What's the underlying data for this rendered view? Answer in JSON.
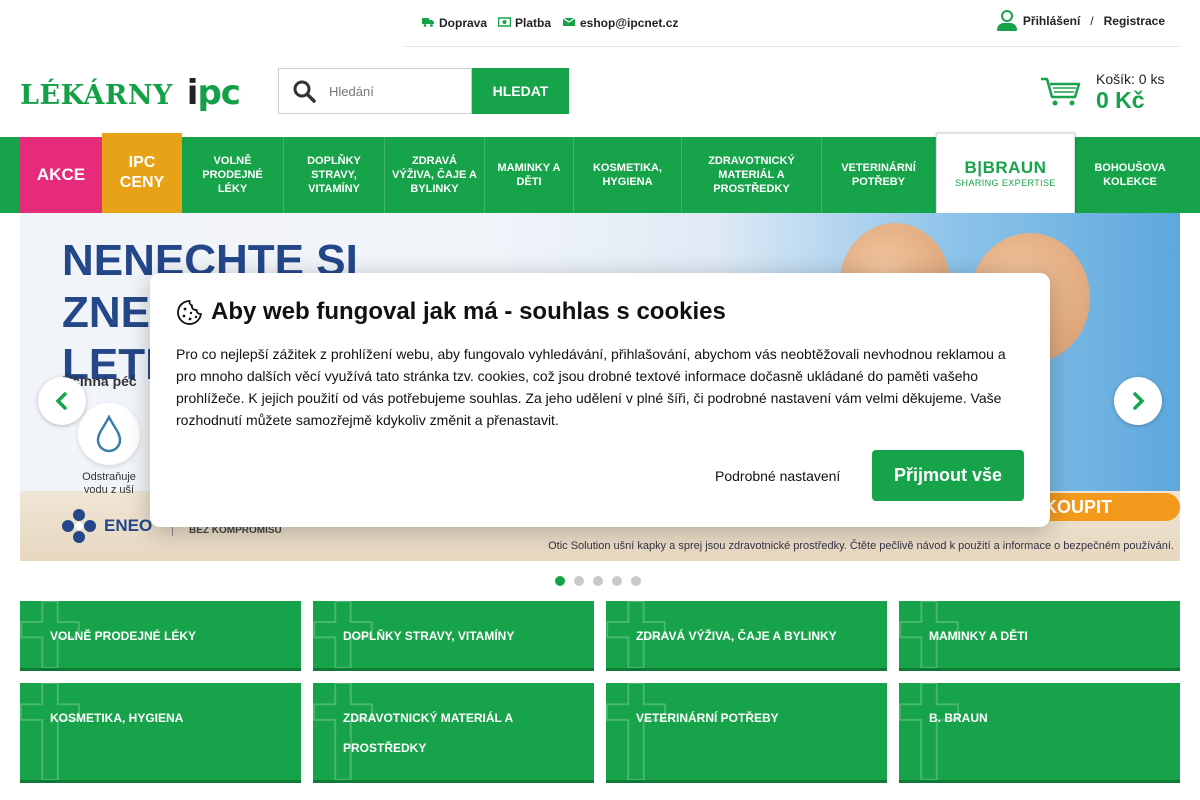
{
  "top_links": [
    {
      "label": "Doprava",
      "icon": "truck-icon"
    },
    {
      "label": "Platba",
      "icon": "banknote-icon"
    },
    {
      "label": "eshop@ipcnet.cz",
      "icon": "envelope-icon"
    }
  ],
  "account": {
    "login": "Přihlášení",
    "separator": "/",
    "register": "Registrace"
  },
  "logo": {
    "text": "LÉKÁRNY",
    "brand_i": "i",
    "brand_pc": "pc"
  },
  "search": {
    "placeholder": "Hledání",
    "button": "HLEDAT"
  },
  "cart": {
    "count_label": "Košík: 0 ks",
    "total": "0 Kč"
  },
  "nav": {
    "akce": "AKCE",
    "ipc_ceny_1": "IPC",
    "ipc_ceny_2": "CENY",
    "items": [
      "VOLNĚ PRODEJNÉ LÉKY",
      "DOPLŇKY STRAVY, VITAMÍNY",
      "ZDRAVÁ VÝŽIVA, ČAJE A BYLINKY",
      "MAMINKY A DĚTI",
      "KOSMETIKA, HYGIENA",
      "ZDRAVOTNICKÝ MATERIÁL A PROSTŘEDKY",
      "VETERINÁRNÍ POTŘEBY"
    ],
    "braun_title": "B|BRAUN",
    "braun_sub": "SHARING EXPERTISE",
    "last": "BOHOUŠOVA KOLEKCE"
  },
  "banner": {
    "headline_1": "NENECHTE SI",
    "headline_2": "ZNE",
    "headline_3": "LETN",
    "sub": "Účinná péč",
    "feature_caption_1": "Odstraňuje",
    "feature_caption_2": "vodu z uší",
    "brand": "ENEO",
    "slogan": "BEZ KOMPROMISŮ",
    "cta": "KOUPIT",
    "note": "Otic Solution ušní kapky a sprej jsou zdravotnické prostředky. Čtěte pečlivě návod k použití a informace o bezpečném používání."
  },
  "slider": {
    "dots": 5,
    "active": 1
  },
  "tiles": [
    "VOLNĚ PRODEJNÉ LÉKY",
    "DOPLŇKY STRAVY, VITAMÍNY",
    "ZDRAVÁ VÝŽIVA, ČAJE A BYLINKY",
    "MAMINKY A DĚTI",
    "KOSMETIKA, HYGIENA",
    "ZDRAVOTNICKÝ MATERIÁL A PROSTŘEDKY",
    "VETERINÁRNÍ POTŘEBY",
    "B. BRAUN"
  ],
  "cookie": {
    "title": "Aby web fungoval jak má - souhlas s cookies",
    "text": "Pro co nejlepší zážitek z prohlížení webu, aby fungovalo vyhledávání, přihlašování, abychom vás neobtěžovali nevhodnou reklamou a pro mnoho dalších věcí využívá tato stránka tzv. cookies, což jsou drobné textové informace dočasně ukládané do paměti vašeho prohlížeče. K jejich použití od vás potřebujeme souhlas. Za jeho udělení v plné šíři, či podrobné nastavení vám velmi děkujeme. Vaše rozhodnutí můžete samozřejmě kdykoliv změnit a přenastavit.",
    "settings": "Podrobné nastavení",
    "accept": "Přijmout vše"
  },
  "colors": {
    "brand_green": "#16a34a",
    "akce_pink": "#e52b7a",
    "ipc_orange": "#e8a217",
    "banner_navy": "#24478a"
  }
}
